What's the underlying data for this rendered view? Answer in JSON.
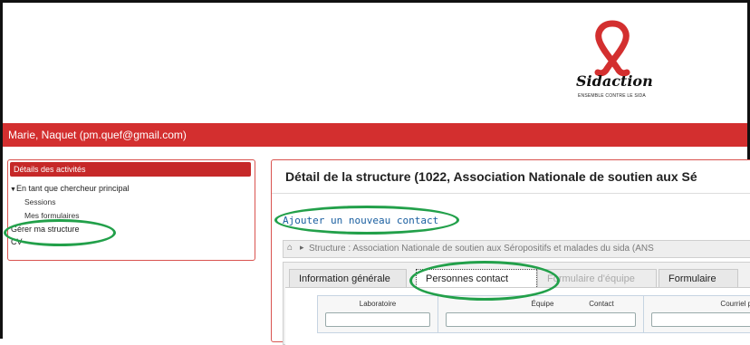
{
  "header": {
    "brand": "Sidaction",
    "tagline": "ENSEMBLE CONTRE LE SIDA"
  },
  "user_bar": {
    "user": "Marie, Naquet (pm.quef@gmail.com)"
  },
  "left_panel": {
    "title": "Détails des activités",
    "items": {
      "role": "En tant que chercheur principal",
      "sessions": "Sessions",
      "forms": "Mes formulaires",
      "manage": "Gérer ma structure",
      "cv": "CV"
    }
  },
  "main": {
    "title": "Détail de la structure (1022, Association Nationale de soutien aux Sé",
    "add_contact": "Ajouter un nouveau contact",
    "breadcrumb": "Structure : Association Nationale de soutien aux Séropositifs et malades du sida (ANS",
    "tabs": [
      {
        "label": "Information générale"
      },
      {
        "label": "Personnes contact"
      },
      {
        "label": "Formulaire d'équipe"
      },
      {
        "label": "Formulaire"
      }
    ],
    "columns": {
      "lab": "Laboratoire",
      "team": "Équipe",
      "contact": "Contact",
      "email": "Courriel prin"
    }
  },
  "colors": {
    "brand_red": "#d32f2f",
    "annotation_green": "#22a04a",
    "link_blue": "#1a5fa0"
  }
}
